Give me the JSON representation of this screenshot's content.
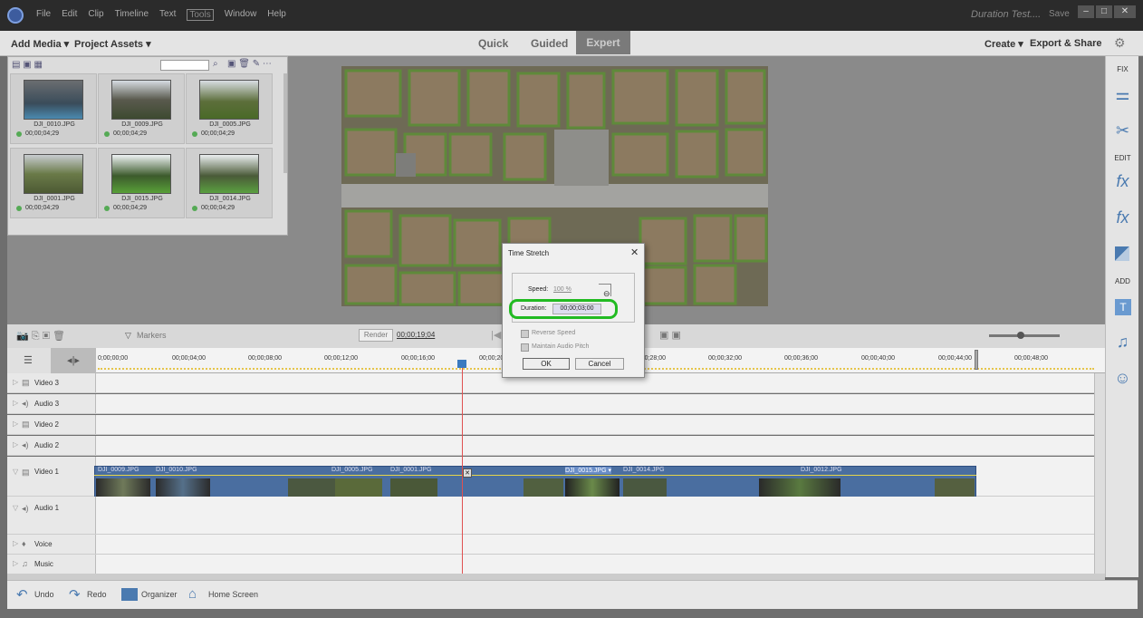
{
  "menu": [
    "File",
    "Edit",
    "Clip",
    "Timeline",
    "Text",
    "Tools",
    "Window",
    "Help"
  ],
  "titlebar": {
    "doc_title": "Duration Test....",
    "save": "Save"
  },
  "toolbar": {
    "add_media": "Add Media ▾",
    "project_assets": "Project Assets ▾",
    "modes": [
      "Quick",
      "Guided",
      "Expert"
    ],
    "create": "Create ▾",
    "export_share": "Export & Share"
  },
  "right_panel": {
    "fix": "FIX",
    "edit": "EDIT",
    "add": "ADD"
  },
  "media": [
    {
      "name": "DJI_0010.JPG",
      "dur": "00;00;04;29"
    },
    {
      "name": "DJI_0009.JPG",
      "dur": "00;00;04;29"
    },
    {
      "name": "DJI_0005.JPG",
      "dur": "00;00;04;29"
    },
    {
      "name": "DJI_0001.JPG",
      "dur": "00;00;04;29"
    },
    {
      "name": "DJI_0015.JPG",
      "dur": "00;00;04;29"
    },
    {
      "name": "DJI_0014.JPG",
      "dur": "00;00;04;29"
    }
  ],
  "timeline_bar": {
    "markers": "Markers",
    "render": "Render",
    "timecode": "00;00;19;04"
  },
  "ruler": [
    "0;00;00;00",
    "00;00;04;00",
    "00;00;08;00",
    "00;00;12;00",
    "00;00;16;00",
    "00;00;20;00",
    "00;00;28;00",
    "00;00;32;00",
    "00;00;36;00",
    "00;00;40;00",
    "00;00;44;00",
    "00;00;48;00"
  ],
  "tracks": [
    "Video 3",
    "Audio 3",
    "Video 2",
    "Audio 2",
    "Video 1",
    "Audio 1",
    "Voice",
    "Music"
  ],
  "clips": [
    "DJI_0009.JPG",
    "DJI_0010.JPG",
    "DJI_0005.JPG",
    "DJI_0001.JPG",
    "DJI_0015.JPG ▾",
    "DJI_0014.JPG",
    "DJI_0012.JPG"
  ],
  "dialog": {
    "title": "Time Stretch",
    "speed_label": "Speed:",
    "speed_value": "100 %",
    "duration_label": "Duration:",
    "duration_value": "00;00;03;00",
    "reverse": "Reverse Speed",
    "maintain": "Maintain Audio Pitch",
    "ok": "OK",
    "cancel": "Cancel"
  },
  "bottom": {
    "undo": "Undo",
    "redo": "Redo",
    "organizer": "Organizer",
    "home": "Home Screen"
  },
  "colors": {
    "accent": "#4a7ab0",
    "highlight": "#22bb22",
    "clip": "#4a6ea0",
    "playhead": "#e05050"
  }
}
